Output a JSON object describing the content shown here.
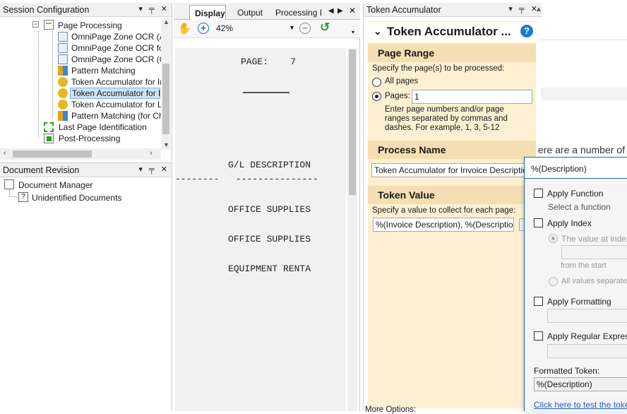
{
  "session_config": {
    "title": "Session Configuration",
    "items": [
      {
        "label": "Page Processing"
      },
      {
        "label": "OmniPage Zone OCR (Alw"
      },
      {
        "label": "OmniPage Zone OCR for L"
      },
      {
        "label": "OmniPage Zone OCR (On"
      },
      {
        "label": "Pattern Matching"
      },
      {
        "label": "Token Accumulator for Inv"
      },
      {
        "label": "Token Accumulator for Inv"
      },
      {
        "label": "Token Accumulator for Leg"
      },
      {
        "label": "Pattern Matching (for Chec"
      },
      {
        "label": "Last Page Identification"
      },
      {
        "label": "Post-Processing"
      }
    ]
  },
  "doc_revision": {
    "title": "Document Revision",
    "items": [
      {
        "label": "Document Manager"
      },
      {
        "label": "Unidentified Documents"
      }
    ]
  },
  "viewer": {
    "tabs": [
      {
        "label": "Display"
      },
      {
        "label": "Output"
      },
      {
        "label": "Processing I"
      }
    ],
    "zoom": "42%",
    "doc_lines": [
      {
        "text": "PAGE:    7"
      },
      {
        "text": "G/L DESCRIPTION"
      },
      {
        "text": "--------   ---------------"
      },
      {
        "text": "OFFICE SUPPLIES"
      },
      {
        "text": "OFFICE SUPPLIES"
      },
      {
        "text": "EQUIPMENT RENTA"
      }
    ]
  },
  "token": {
    "pane_title": "Token Accumulator",
    "title": "Token Accumulator ...",
    "page_range": {
      "heading": "Page Range",
      "instruction": "Specify the page(s) to be processed:",
      "all_pages": "All pages",
      "pages": "Pages:",
      "pages_value": "1",
      "hint": "Enter page numbers and/or page ranges separated by commas and dashes.  For example, 1, 3, 5-12"
    },
    "process_name": {
      "heading": "Process Name",
      "value": "Token Accumulator for Invoice Description"
    },
    "token_value": {
      "heading": "Token Value",
      "instruction": "Specify a value to collect for each page:",
      "value": "%(Invoice Description), %(Description)"
    },
    "more_options": "More Options:"
  },
  "background_text": "ere are a number of",
  "popup": {
    "header": "%(Description)",
    "apply_function": "Apply Function",
    "select_function": "Select a function",
    "apply_index": "Apply Index",
    "value_at_index": "The value at index:",
    "from_start": "from the  start",
    "all_values": "All values separated",
    "apply_formatting": "Apply Formatting",
    "apply_regex": "Apply Regular Expressio",
    "formatted_label": "Formatted Token:",
    "formatted_value": "%(Description)",
    "test_link": "Click here to test the token"
  }
}
